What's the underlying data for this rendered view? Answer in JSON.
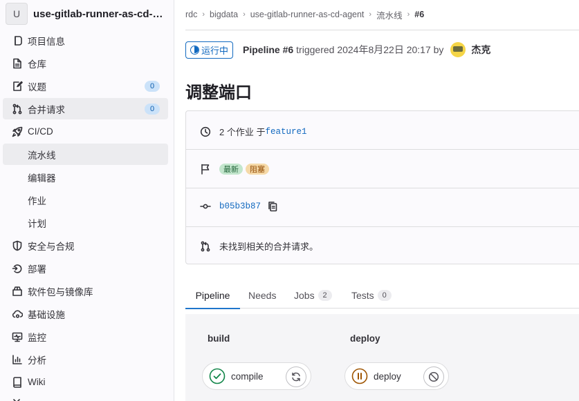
{
  "project": {
    "avatar_letter": "U",
    "name": "use-gitlab-runner-as-cd-agent"
  },
  "sidebar": {
    "items": [
      {
        "label": "项目信息"
      },
      {
        "label": "仓库"
      },
      {
        "label": "议题",
        "count": "0"
      },
      {
        "label": "合并请求",
        "count": "0"
      },
      {
        "label": "CI/CD"
      },
      {
        "label": "流水线"
      },
      {
        "label": "编辑器"
      },
      {
        "label": "作业"
      },
      {
        "label": "计划"
      },
      {
        "label": "安全与合规"
      },
      {
        "label": "部署"
      },
      {
        "label": "软件包与镜像库"
      },
      {
        "label": "基础设施"
      },
      {
        "label": "监控"
      },
      {
        "label": "分析"
      },
      {
        "label": "Wiki"
      }
    ]
  },
  "breadcrumb": [
    "rdc",
    "bigdata",
    "use-gitlab-runner-as-cd-agent",
    "流水线",
    "#6"
  ],
  "header": {
    "status": "运行中",
    "pipeline": "Pipeline #6",
    "triggered_text": "triggered 2024年8月22日 20:17 by",
    "user": "杰克"
  },
  "page_title": "调整端口",
  "info": {
    "jobs_prefix": "2 个作业 于",
    "branch": "feature1",
    "badge_latest": "最新",
    "badge_blocked": "阻塞",
    "commit_sha": "b05b3b87",
    "mr_text": "未找到相关的合并请求。"
  },
  "tabs": [
    {
      "label": "Pipeline"
    },
    {
      "label": "Needs"
    },
    {
      "label": "Jobs",
      "count": "2"
    },
    {
      "label": "Tests",
      "count": "0"
    }
  ],
  "stages": [
    {
      "name": "build",
      "job": "compile"
    },
    {
      "name": "deploy",
      "job": "deploy"
    }
  ],
  "colors": {
    "accent": "#1068bf",
    "success": "#108548",
    "manual": "#9e5400",
    "sidebar_bg": "#fbfafd"
  }
}
